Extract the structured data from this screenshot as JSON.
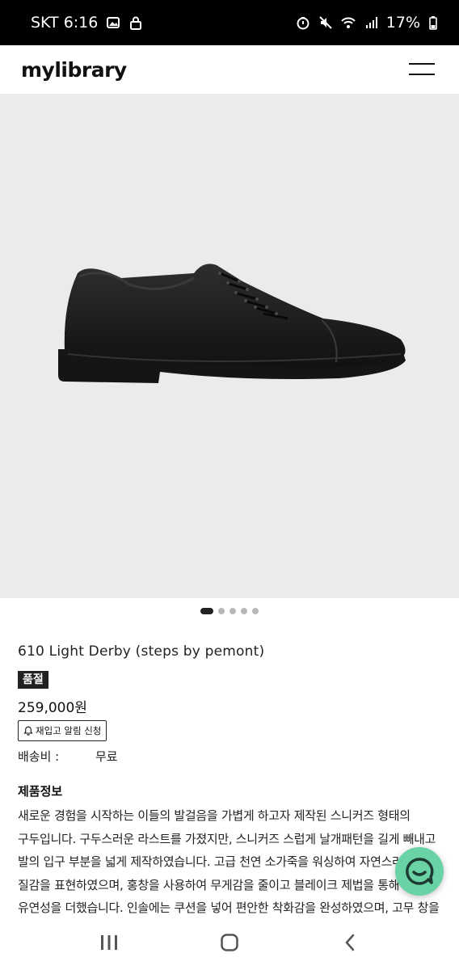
{
  "status_bar": {
    "carrier_time": "SKT 6:16",
    "battery": "17%",
    "icons": [
      "gallery-icon",
      "lock-icon",
      "battery-saver-icon",
      "mute-icon",
      "wifi-icon",
      "signal-icon",
      "battery-icon"
    ]
  },
  "header": {
    "logo": "mylibrary",
    "menu_icon": "hamburger-menu-icon"
  },
  "gallery": {
    "total": 5,
    "current": 1
  },
  "product": {
    "name": "610 Light Derby (steps by pemont)",
    "badge": "품절",
    "price": "259,000원",
    "restock_label": "재입고 알림 신청",
    "shipping_label": "배송비 :",
    "shipping_value": "무료",
    "info_title": "제품정보",
    "description": "새로운 경험을 시작하는 이들의 발걸음을 가볍게 하고자 제작된 스니커즈 형태의 구두입니다. 구두스러운 라스트를 가졌지만, 스니커즈 스럽게 날개패턴을 길게 빼내고 발의 입구 부분을 넓게 제작하였습니다. 고급 천연 소가죽을 워싱하여 자연스러운 질감을 표현하였으며, 홍창을 사용하여 무게감을 줄이고 블레이크 제법을 통해 유연성을 더했습니다. 인솔에는 쿠션을 넣어 편안한 착화감을 완성하였으며, 고무 창을 덧대어 내구성을 높였습니다."
  },
  "colors": {
    "accent_chat": "#69d3a5",
    "badge_bg": "#222222",
    "hero_bg": "#ebebeb"
  }
}
